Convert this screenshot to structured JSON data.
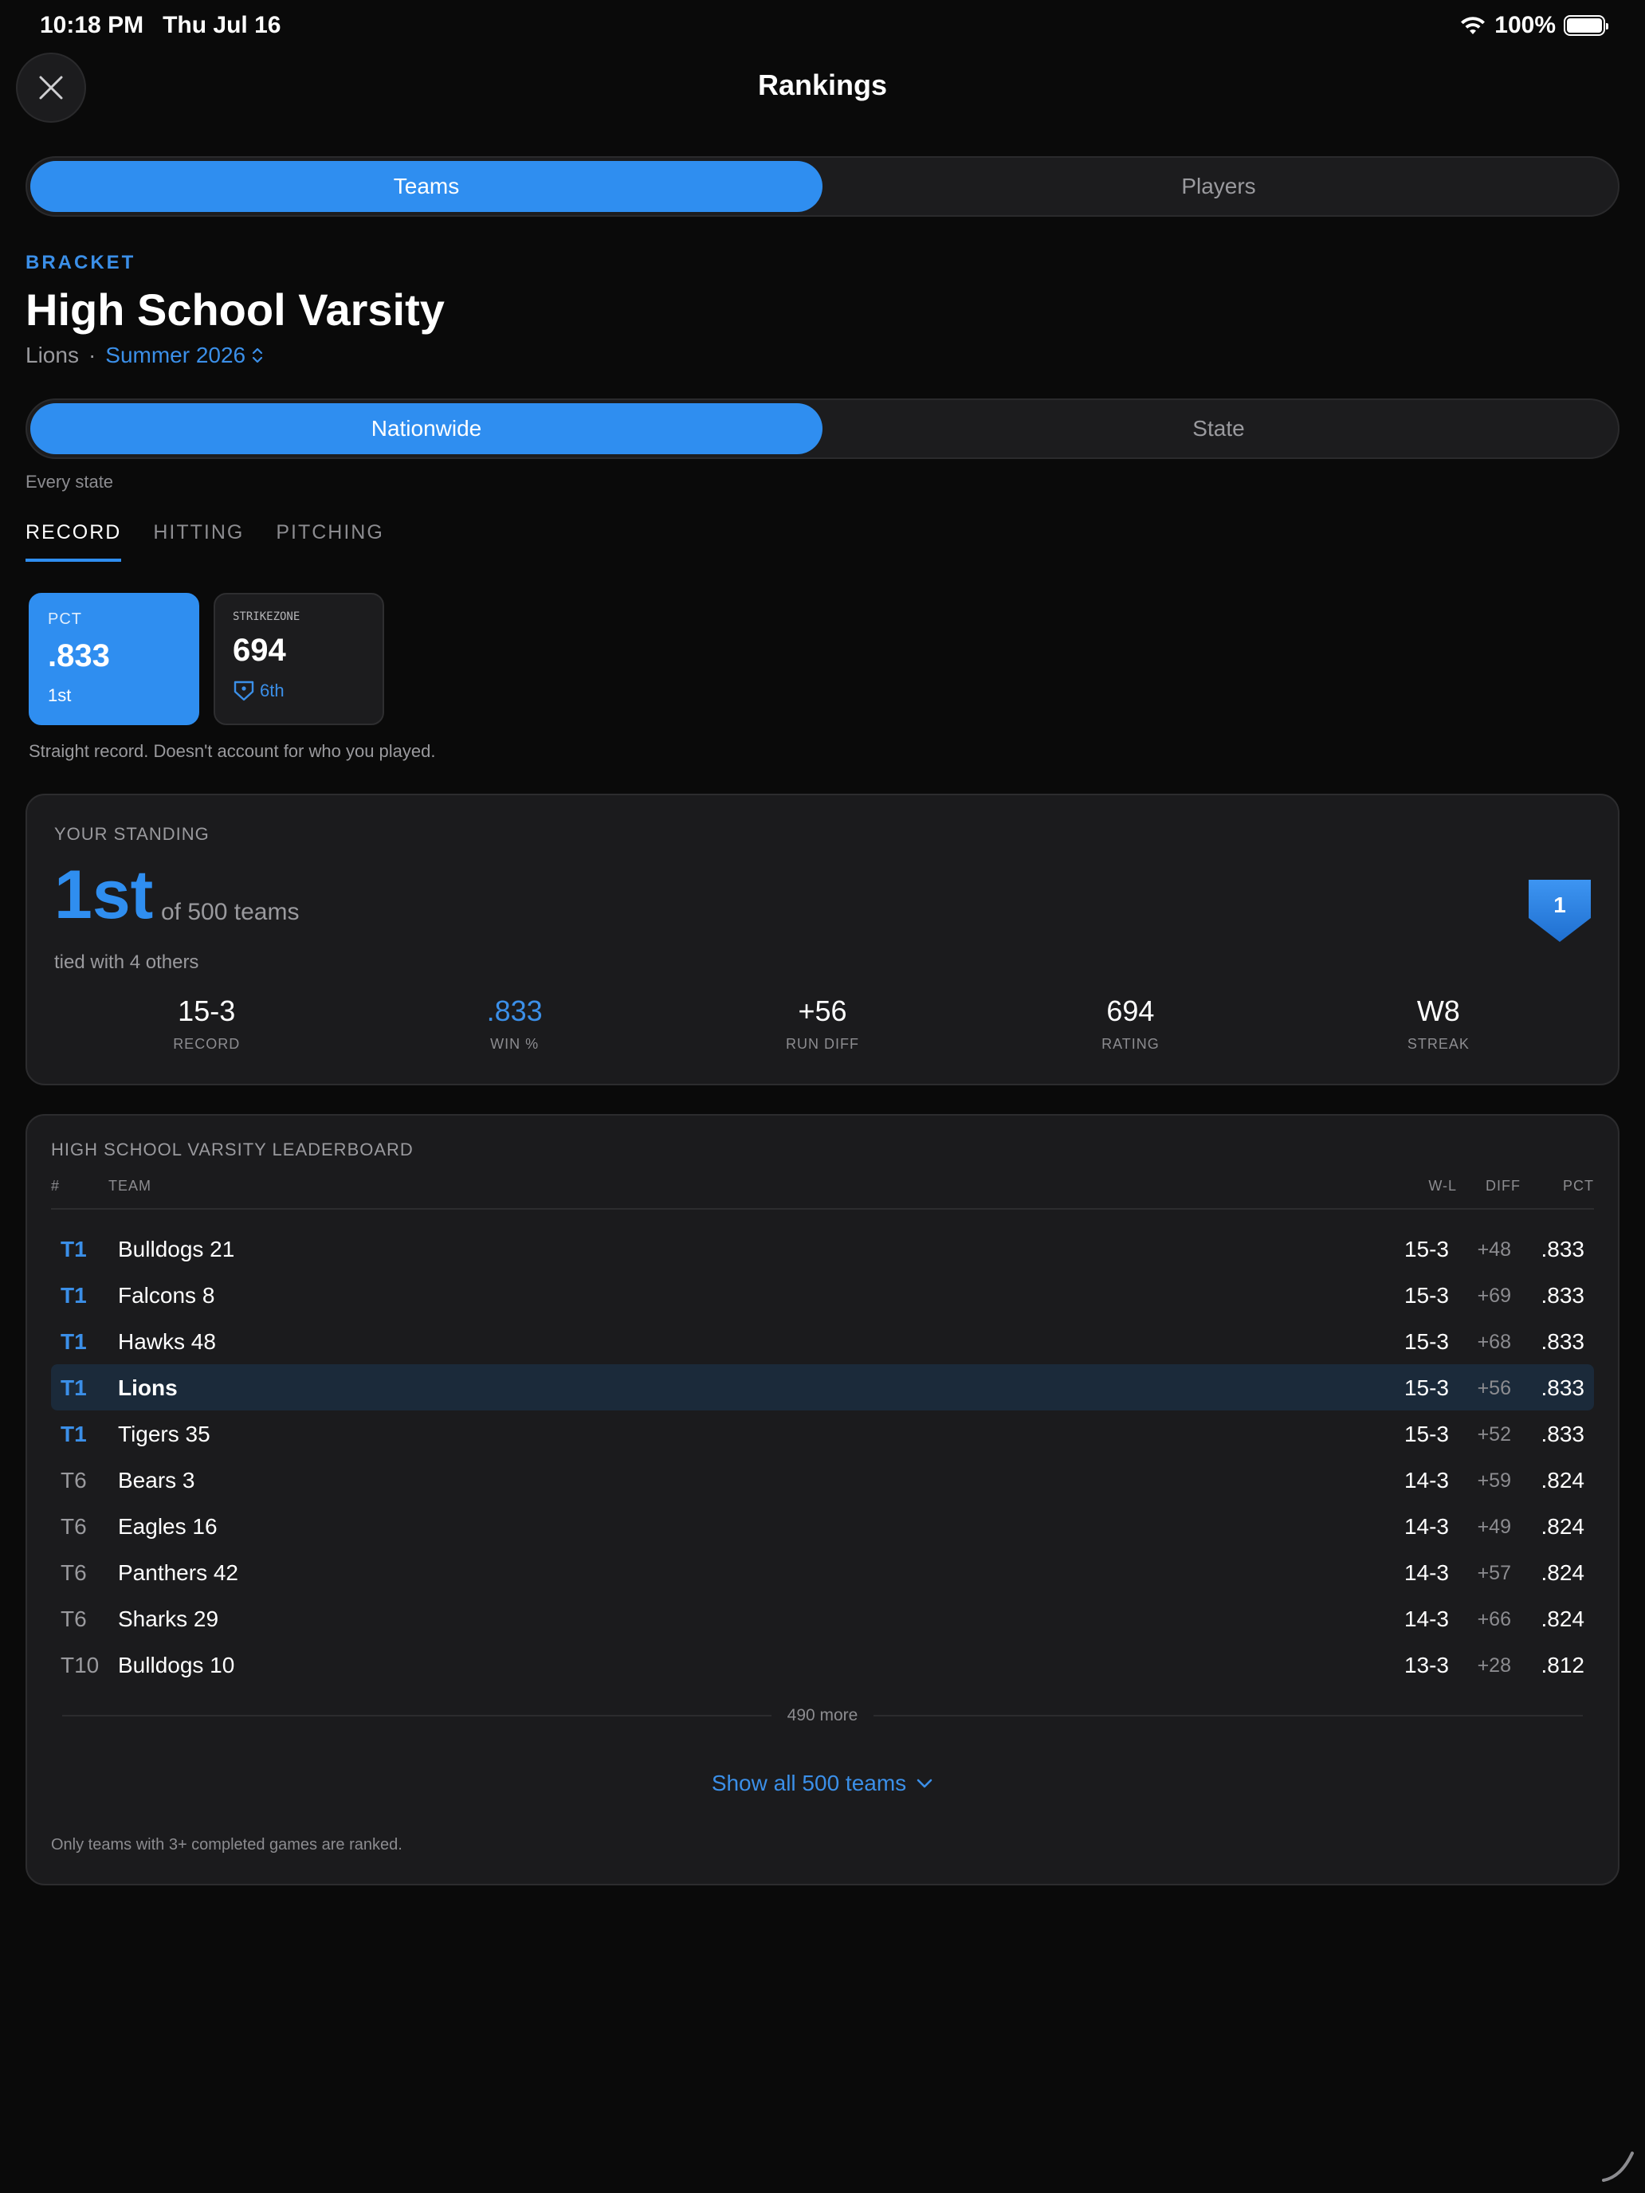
{
  "status": {
    "time": "10:18 PM",
    "date": "Thu Jul 16",
    "battery": "100%"
  },
  "header": {
    "title": "Rankings"
  },
  "type_toggle": {
    "options": [
      "Teams",
      "Players"
    ],
    "selected": "Teams"
  },
  "bracket": {
    "label": "BRACKET",
    "title": "High School Varsity",
    "team": "Lions",
    "separator": "·",
    "season": "Summer 2026"
  },
  "scope_toggle": {
    "options": [
      "Nationwide",
      "State"
    ],
    "selected": "Nationwide",
    "caption": "Every state"
  },
  "tabs": [
    "RECORD",
    "HITTING",
    "PITCHING"
  ],
  "metrics": [
    {
      "label": "PCT",
      "value": ".833",
      "rank": "1st"
    },
    {
      "label": "STRIKEZONE",
      "value": "694",
      "rank": "6th"
    }
  ],
  "metric_caption": "Straight record. Doesn't account for who you played.",
  "standing": {
    "label": "YOUR STANDING",
    "rank": "1st",
    "of_text": "of 500 teams",
    "tied": "tied with 4 others",
    "badge": "1",
    "stats": [
      {
        "value": "15-3",
        "label": "RECORD"
      },
      {
        "value": ".833",
        "label": "WIN %"
      },
      {
        "value": "+56",
        "label": "RUN DIFF"
      },
      {
        "value": "694",
        "label": "RATING"
      },
      {
        "value": "W8",
        "label": "STREAK"
      }
    ]
  },
  "leaderboard": {
    "title": "HIGH SCHOOL VARSITY LEADERBOARD",
    "columns": {
      "rank": "#",
      "team": "TEAM",
      "wl": "W-L",
      "diff": "DIFF",
      "pct": "PCT"
    },
    "rows": [
      {
        "rank": "T1",
        "team": "Bulldogs 21",
        "wl": "15-3",
        "diff": "+48",
        "pct": ".833"
      },
      {
        "rank": "T1",
        "team": "Falcons 8",
        "wl": "15-3",
        "diff": "+69",
        "pct": ".833"
      },
      {
        "rank": "T1",
        "team": "Hawks 48",
        "wl": "15-3",
        "diff": "+68",
        "pct": ".833"
      },
      {
        "rank": "T1",
        "team": "Lions",
        "wl": "15-3",
        "diff": "+56",
        "pct": ".833"
      },
      {
        "rank": "T1",
        "team": "Tigers 35",
        "wl": "15-3",
        "diff": "+52",
        "pct": ".833"
      },
      {
        "rank": "T6",
        "team": "Bears 3",
        "wl": "14-3",
        "diff": "+59",
        "pct": ".824"
      },
      {
        "rank": "T6",
        "team": "Eagles 16",
        "wl": "14-3",
        "diff": "+49",
        "pct": ".824"
      },
      {
        "rank": "T6",
        "team": "Panthers 42",
        "wl": "14-3",
        "diff": "+57",
        "pct": ".824"
      },
      {
        "rank": "T6",
        "team": "Sharks 29",
        "wl": "14-3",
        "diff": "+66",
        "pct": ".824"
      },
      {
        "rank": "T10",
        "team": "Bulldogs 10",
        "wl": "13-3",
        "diff": "+28",
        "pct": ".812"
      }
    ],
    "more": "490 more",
    "show_all": "Show all 500 teams",
    "note": "Only teams with 3+ completed games are ranked."
  },
  "colors": {
    "accent": "#2f8ef0",
    "background": "#0a0a0a",
    "panel": "#1b1b1d",
    "highlight_row": "#1b2a3a"
  }
}
